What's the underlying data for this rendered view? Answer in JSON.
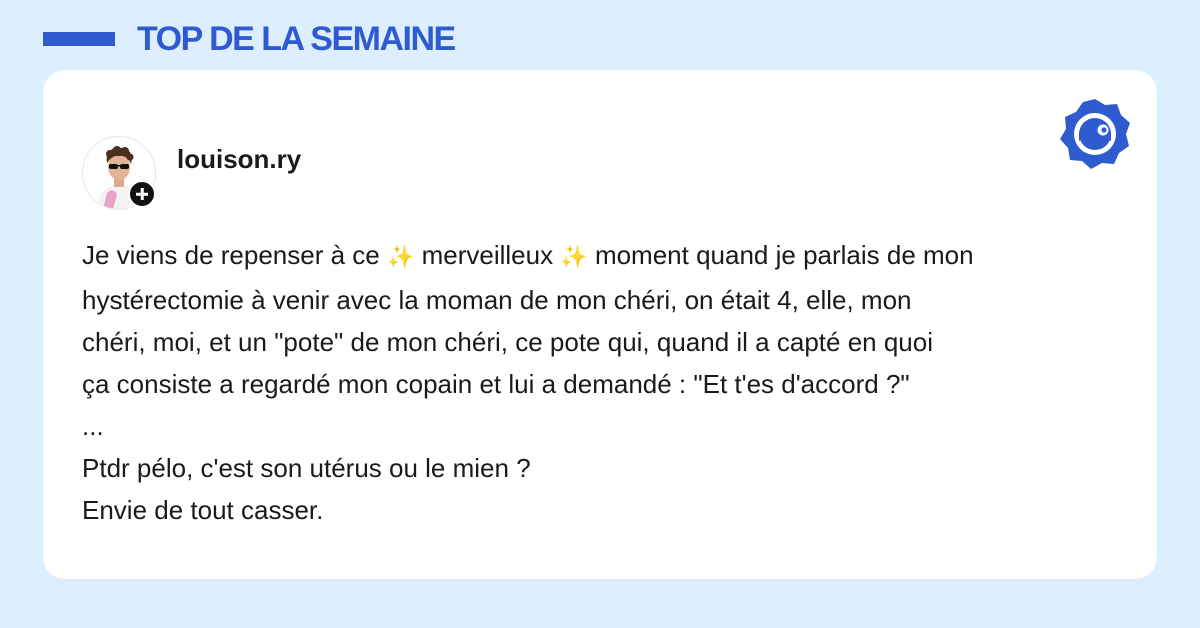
{
  "header": {
    "title": "TOP DE LA SEMAINE",
    "accent_color": "#2f5bd0"
  },
  "post": {
    "username": "louison.ry",
    "avatar_icon": "profile-photo",
    "follow_icon": "plus-icon",
    "brand_icon": "madmoizelle-logo-icon",
    "text_segments": [
      "Je viens de repenser à ce ",
      "✨",
      " merveilleux ",
      "✨",
      " moment quand je parlais de mon"
    ],
    "lines": [
      "hystérectomie à venir avec la moman de mon chéri, on était 4, elle, mon",
      "chéri, moi, et un \"pote\" de mon chéri, ce pote qui, quand il a capté en quoi",
      "ça consiste a regardé mon copain et lui a demandé : \"Et t'es d'accord ?\"",
      "...",
      "Ptdr pélo, c'est son utérus ou le mien ?",
      "Envie de tout casser."
    ]
  }
}
